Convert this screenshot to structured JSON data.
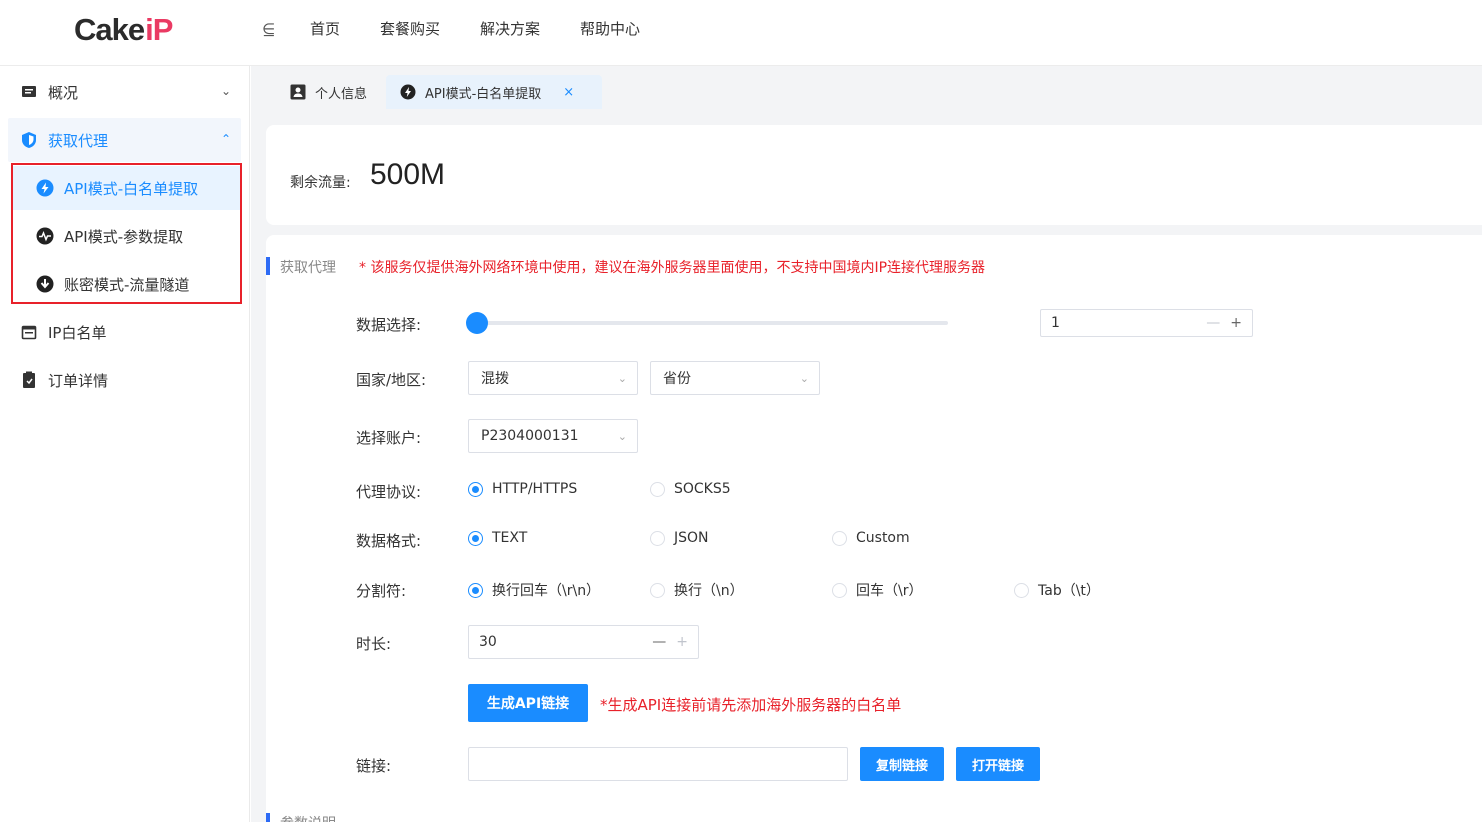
{
  "logo": {
    "part1": "Cake",
    "part2": "iP"
  },
  "topnav": {
    "toggle": "⋸",
    "items": [
      "首页",
      "套餐购买",
      "解决方案",
      "帮助中心"
    ]
  },
  "sidebar": {
    "overview": "概况",
    "get_proxy": "获取代理",
    "sub": [
      "API模式-白名单提取",
      "API模式-参数提取",
      "账密模式-流量隧道"
    ],
    "ip_whitelist": "IP白名单",
    "orders": "订单详情"
  },
  "tabs": {
    "t1": "个人信息",
    "t2": "API模式-白名单提取",
    "close": "×"
  },
  "traffic": {
    "label": "剩余流量:",
    "value": "500M"
  },
  "form": {
    "section_title": "获取代理",
    "section_note": "* 该服务仅提供海外网络环境中使用，建议在海外服务器里面使用，不支持中国境内IP连接代理服务器",
    "data_select_label": "数据选择:",
    "data_count": "1",
    "slider_fraction": 0.0,
    "region_label": "国家/地区:",
    "country_value": "混拨",
    "province_value": "省份",
    "account_label": "选择账户:",
    "account_value": "P2304000131",
    "protocol_label": "代理协议:",
    "protocols": [
      "HTTP/HTTPS",
      "SOCKS5"
    ],
    "format_label": "数据格式:",
    "formats": [
      "TEXT",
      "JSON",
      "Custom"
    ],
    "separator_label": "分割符:",
    "separators": [
      "换行回车（\\r\\n）",
      "换行（\\n）",
      "回车（\\r）",
      "Tab（\\t）"
    ],
    "duration_label": "时长:",
    "duration_value": "30",
    "generate_button": "生成API链接",
    "generate_note": "*生成API连接前请先添加海外服务器的白名单",
    "link_label": "链接:",
    "link_value": "",
    "copy_button": "复制链接",
    "open_button": "打开链接",
    "section2_title": "参数说明"
  },
  "colors": {
    "accent": "#1a8cff",
    "warning": "#e8212a",
    "logo_ip": "#ea3a63"
  }
}
